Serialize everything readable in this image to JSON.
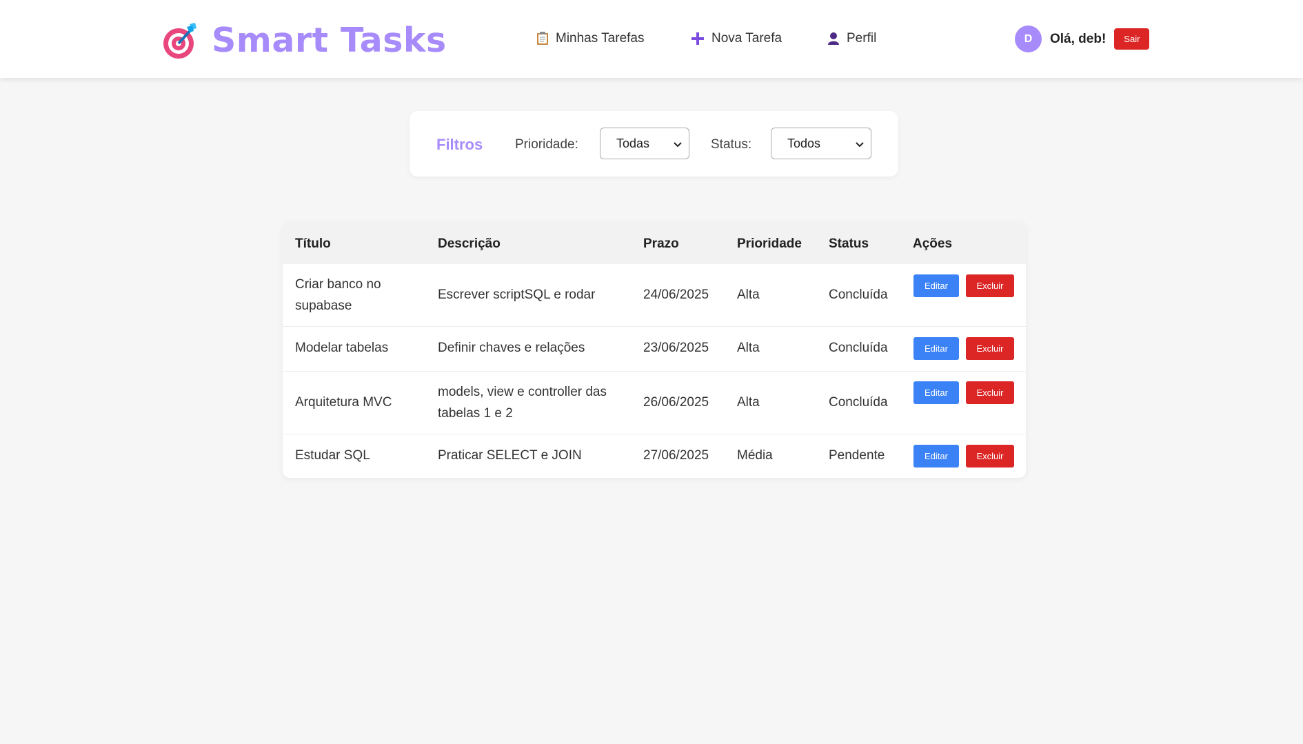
{
  "header": {
    "app_title": "Smart Tasks",
    "logo_icon": "target-dart-icon",
    "nav": [
      {
        "label": "Minhas Tarefas",
        "icon": "clipboard-icon"
      },
      {
        "label": "Nova Tarefa",
        "icon": "plus-icon"
      },
      {
        "label": "Perfil",
        "icon": "user-icon"
      }
    ],
    "user": {
      "avatar_letter": "D",
      "greeting": "Olá, deb!",
      "logout_label": "Sair"
    }
  },
  "filters": {
    "title": "Filtros",
    "priority_label": "Prioridade:",
    "priority_value": "Todas",
    "status_label": "Status:",
    "status_value": "Todos"
  },
  "table": {
    "columns": [
      "Título",
      "Descrição",
      "Prazo",
      "Prioridade",
      "Status",
      "Ações"
    ],
    "rows": [
      {
        "title": "Criar banco no supabase",
        "description": "Escrever scriptSQL e rodar",
        "deadline": "24/06/2025",
        "priority": "Alta",
        "status": "Concluída"
      },
      {
        "title": "Modelar tabelas",
        "description": "Definir chaves e relações",
        "deadline": "23/06/2025",
        "priority": "Alta",
        "status": "Concluída"
      },
      {
        "title": "Arquitetura MVC",
        "description": "models, view e controller das tabelas 1 e 2",
        "deadline": "26/06/2025",
        "priority": "Alta",
        "status": "Concluída"
      },
      {
        "title": "Estudar SQL",
        "description": "Praticar SELECT e JOIN",
        "deadline": "27/06/2025",
        "priority": "Média",
        "status": "Pendente"
      }
    ],
    "edit_label": "Editar",
    "delete_label": "Excluir"
  },
  "colors": {
    "brand": "#a78bfa",
    "danger": "#dc2626",
    "primary": "#3b82f6"
  }
}
